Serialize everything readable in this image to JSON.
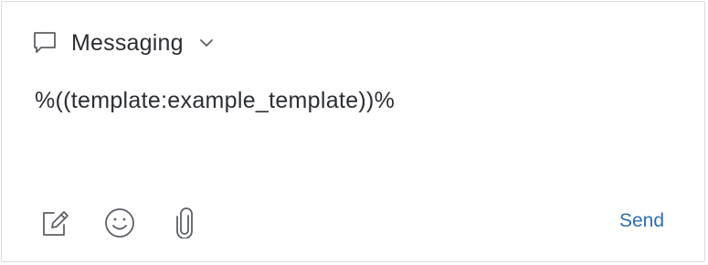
{
  "channel": {
    "label": "Messaging",
    "icon": "speech-bubble-icon",
    "dropdown_icon": "chevron-down-icon"
  },
  "message": {
    "text": "%((template:example_template))%"
  },
  "toolbar": {
    "icons": [
      "compose-icon",
      "emoji-icon",
      "attachment-icon"
    ],
    "send_label": "Send"
  },
  "colors": {
    "text": "#2b2e33",
    "icon": "#5c6066",
    "accent": "#2e6db4",
    "border": "#d9dadd"
  }
}
